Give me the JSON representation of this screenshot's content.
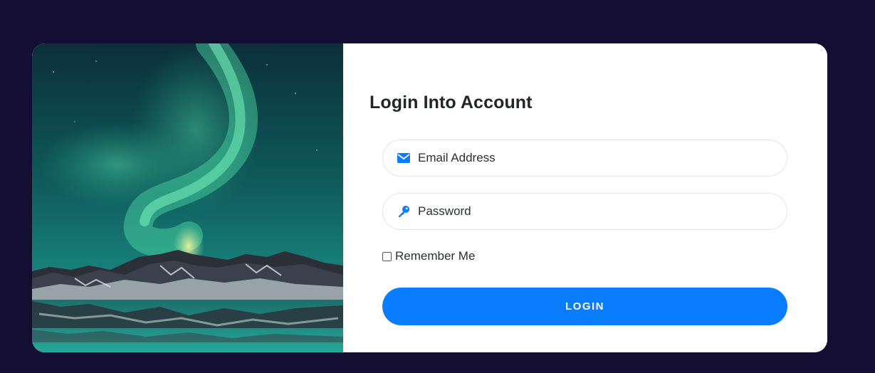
{
  "form": {
    "title": "Login Into Account",
    "email": {
      "placeholder": "Email Address",
      "value": "",
      "icon": "envelope-icon"
    },
    "password": {
      "placeholder": "Password",
      "value": "",
      "icon": "key-icon"
    },
    "remember_label": "Remember Me",
    "remember_checked": false,
    "login_label": "LOGIN"
  },
  "colors": {
    "page_background": "#140e33",
    "accent": "#0a7cff",
    "card": "#ffffff"
  },
  "hero": {
    "icon": "aurora-landscape-image"
  }
}
